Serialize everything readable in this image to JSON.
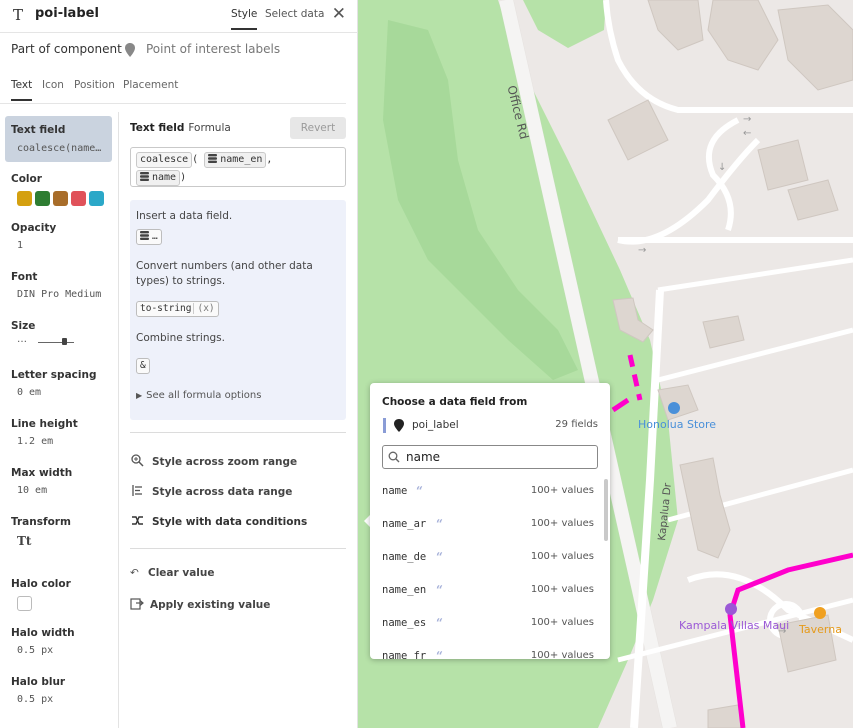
{
  "header": {
    "title": "poi-label",
    "tabs": {
      "style": "Style",
      "select_data": "Select data"
    }
  },
  "component": {
    "prefix": "Part of component",
    "name": "Point of interest labels"
  },
  "subtabs": [
    "Text",
    "Icon",
    "Position",
    "Placement"
  ],
  "properties": {
    "text_field": {
      "label": "Text field",
      "value": "coalesce(name…"
    },
    "color": {
      "label": "Color",
      "swatches": [
        "#d4a010",
        "#2e7d32",
        "#a86d2a",
        "#e0525a",
        "#2ba8c8"
      ]
    },
    "opacity": {
      "label": "Opacity",
      "value": "1"
    },
    "font": {
      "label": "Font",
      "value": "DIN Pro Medium"
    },
    "size": {
      "label": "Size",
      "value": "…"
    },
    "letter_spacing": {
      "label": "Letter spacing",
      "value": "0 em"
    },
    "line_height": {
      "label": "Line height",
      "value": "1.2 em"
    },
    "max_width": {
      "label": "Max width",
      "value": "10 em"
    },
    "transform": {
      "label": "Transform",
      "value": "Tt"
    },
    "halo_color": {
      "label": "Halo color"
    },
    "halo_width": {
      "label": "Halo width",
      "value": "0.5 px"
    },
    "halo_blur": {
      "label": "Halo blur",
      "value": "0.5 px"
    }
  },
  "editor": {
    "heading": "Text field",
    "mode": "Formula",
    "revert": "Revert",
    "expression": {
      "func": "coalesce",
      "open": "(",
      "field1": "name_en",
      "comma": ",",
      "field2": "name",
      "close": ")"
    },
    "hint": {
      "insert_text": "Insert a data field.",
      "insert_chip": "…",
      "convert_text": "Convert numbers (and other data types) to strings.",
      "convert_chip": "to-string",
      "convert_arg": "(x)",
      "combine_text": "Combine strings.",
      "combine_chip": "&",
      "more": "See all formula options"
    },
    "options": [
      "Style across zoom range",
      "Style across data range",
      "Style with data conditions"
    ],
    "actions": [
      "Clear value",
      "Apply existing value"
    ]
  },
  "map": {
    "labels": {
      "road1": "Office Rd",
      "road2": "Kapalua Dr",
      "poi1": "Honolua Store",
      "poi2": "Kampala Villas Maui",
      "poi3": "Taverna"
    },
    "colors": {
      "park": "#b6e2a8",
      "road": "#ffffff",
      "route": "#ff00cc",
      "building": "#ddd6d0",
      "poi_blue": "#4a90d9",
      "poi_purple": "#9b59d6",
      "poi_orange": "#f0a020"
    }
  },
  "popover": {
    "title": "Choose a data field from",
    "source": "poi_label",
    "count": "29 fields",
    "search_value": "name",
    "fields": [
      {
        "name": "name",
        "values": "100+ values"
      },
      {
        "name": "name_ar",
        "values": "100+ values"
      },
      {
        "name": "name_de",
        "values": "100+ values"
      },
      {
        "name": "name_en",
        "values": "100+ values"
      },
      {
        "name": "name_es",
        "values": "100+ values"
      },
      {
        "name": "name_fr",
        "values": "100+ values"
      }
    ]
  }
}
